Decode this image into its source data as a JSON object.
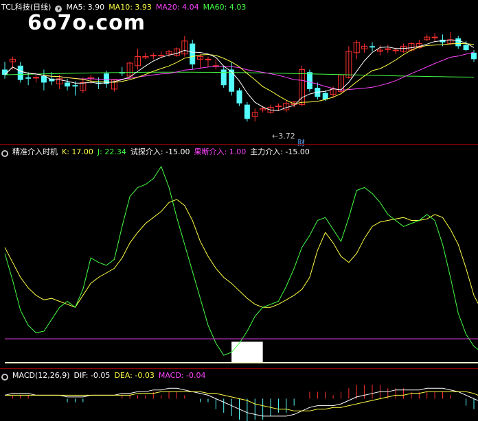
{
  "panels": {
    "main": {
      "title": "TCL科技(日线)",
      "ma": [
        {
          "label": "MA5: 3.90",
          "color": "#ffffff"
        },
        {
          "label": "MA10: 3.93",
          "color": "#ffff44"
        },
        {
          "label": "MA20: 4.04",
          "color": "#ff44ff"
        },
        {
          "label": "MA60: 4.03",
          "color": "#44ff44"
        }
      ],
      "watermark": "6o7o.com",
      "low_label": "3.72",
      "marker": "财"
    },
    "kdj": {
      "title": "精准介入时机",
      "items": [
        {
          "label": "K: 17.00",
          "color": "#ffff44"
        },
        {
          "label": "J: 22.34",
          "color": "#44ff44"
        },
        {
          "label": "试探介入: -15.00",
          "color": "#ffffff"
        },
        {
          "label": "果断介入: 1.00",
          "color": "#ff44ff"
        },
        {
          "label": "主力介入: -15.00",
          "color": "#ffffff"
        }
      ]
    },
    "macd": {
      "title": "MACD(12,26,9)",
      "items": [
        {
          "label": "DIF: -0.05",
          "color": "#ffffff"
        },
        {
          "label": "DEA: -0.03",
          "color": "#ffff44"
        },
        {
          "label": "MACD: -0.04",
          "color": "#ff44ff"
        }
      ]
    }
  },
  "colors": {
    "up": "#ff3030",
    "down": "#54ffff",
    "ma5": "#ffffff",
    "ma10": "#ffff44",
    "ma20": "#ff44ff",
    "ma60": "#44ff44"
  },
  "chart_data": [
    {
      "type": "candlestick",
      "price_range": [
        3.6,
        4.55
      ],
      "candles": [
        {
          "o": 4.12,
          "h": 4.18,
          "l": 4.05,
          "c": 4.08
        },
        {
          "o": 4.18,
          "h": 4.22,
          "l": 4.12,
          "c": 4.2
        },
        {
          "o": 4.15,
          "h": 4.18,
          "l": 4.02,
          "c": 4.04
        },
        {
          "o": 4.06,
          "h": 4.1,
          "l": 4.0,
          "c": 4.05
        },
        {
          "o": 4.06,
          "h": 4.08,
          "l": 4.02,
          "c": 4.06
        },
        {
          "o": 4.07,
          "h": 4.12,
          "l": 3.96,
          "c": 4.02
        },
        {
          "o": 4.05,
          "h": 4.1,
          "l": 4.0,
          "c": 4.03
        },
        {
          "o": 4.01,
          "h": 4.08,
          "l": 3.97,
          "c": 4.05
        },
        {
          "o": 4.02,
          "h": 4.05,
          "l": 3.96,
          "c": 3.99
        },
        {
          "o": 4.0,
          "h": 4.03,
          "l": 3.92,
          "c": 3.99
        },
        {
          "o": 3.96,
          "h": 4.06,
          "l": 3.94,
          "c": 4.02
        },
        {
          "o": 4.05,
          "h": 4.08,
          "l": 4.01,
          "c": 4.06
        },
        {
          "o": 4.02,
          "h": 4.06,
          "l": 3.97,
          "c": 4.01
        },
        {
          "o": 4.09,
          "h": 4.11,
          "l": 3.98,
          "c": 4.01
        },
        {
          "o": 3.97,
          "h": 4.04,
          "l": 3.95,
          "c": 4.04
        },
        {
          "o": 4.1,
          "h": 4.14,
          "l": 4.07,
          "c": 4.09
        },
        {
          "o": 4.07,
          "h": 4.18,
          "l": 4.05,
          "c": 4.17
        },
        {
          "o": 4.15,
          "h": 4.28,
          "l": 4.12,
          "c": 4.22
        },
        {
          "o": 4.21,
          "h": 4.25,
          "l": 4.2,
          "c": 4.22
        },
        {
          "o": 4.23,
          "h": 4.25,
          "l": 4.2,
          "c": 4.23
        },
        {
          "o": 4.23,
          "h": 4.26,
          "l": 4.21,
          "c": 4.23
        },
        {
          "o": 4.24,
          "h": 4.27,
          "l": 4.22,
          "c": 4.26
        },
        {
          "o": 4.23,
          "h": 4.29,
          "l": 4.22,
          "c": 4.28
        },
        {
          "o": 4.24,
          "h": 4.38,
          "l": 4.22,
          "c": 4.34
        },
        {
          "o": 4.32,
          "h": 4.35,
          "l": 4.12,
          "c": 4.16
        },
        {
          "o": 4.2,
          "h": 4.24,
          "l": 4.13,
          "c": 4.22
        },
        {
          "o": 4.2,
          "h": 4.22,
          "l": 4.14,
          "c": 4.2
        },
        {
          "o": 4.15,
          "h": 4.2,
          "l": 4.12,
          "c": 4.15
        },
        {
          "o": 4.12,
          "h": 4.15,
          "l": 3.98,
          "c": 4.0
        },
        {
          "o": 4.12,
          "h": 4.18,
          "l": 3.92,
          "c": 3.95
        },
        {
          "o": 3.96,
          "h": 3.98,
          "l": 3.84,
          "c": 3.86
        },
        {
          "o": 3.85,
          "h": 3.87,
          "l": 3.72,
          "c": 3.74
        },
        {
          "o": 3.76,
          "h": 3.82,
          "l": 3.72,
          "c": 3.79
        },
        {
          "o": 3.81,
          "h": 3.84,
          "l": 3.79,
          "c": 3.82
        },
        {
          "o": 3.79,
          "h": 3.85,
          "l": 3.78,
          "c": 3.83
        },
        {
          "o": 3.84,
          "h": 3.86,
          "l": 3.8,
          "c": 3.84
        },
        {
          "o": 3.81,
          "h": 3.88,
          "l": 3.79,
          "c": 3.86
        },
        {
          "o": 3.85,
          "h": 3.88,
          "l": 3.83,
          "c": 3.87
        },
        {
          "o": 3.85,
          "h": 4.15,
          "l": 3.84,
          "c": 4.12
        },
        {
          "o": 4.1,
          "h": 4.12,
          "l": 3.95,
          "c": 3.97
        },
        {
          "o": 3.98,
          "h": 4.02,
          "l": 3.89,
          "c": 3.91
        },
        {
          "o": 3.94,
          "h": 3.96,
          "l": 3.88,
          "c": 3.89
        },
        {
          "o": 3.93,
          "h": 3.99,
          "l": 3.9,
          "c": 3.97
        },
        {
          "o": 3.95,
          "h": 4.08,
          "l": 3.93,
          "c": 4.08
        },
        {
          "o": 4.06,
          "h": 4.3,
          "l": 4.05,
          "c": 4.26
        },
        {
          "o": 4.25,
          "h": 4.35,
          "l": 4.2,
          "c": 4.33
        },
        {
          "o": 4.28,
          "h": 4.32,
          "l": 4.25,
          "c": 4.3
        },
        {
          "o": 4.3,
          "h": 4.33,
          "l": 4.26,
          "c": 4.29
        },
        {
          "o": 4.26,
          "h": 4.31,
          "l": 4.23,
          "c": 4.27
        },
        {
          "o": 4.28,
          "h": 4.31,
          "l": 4.25,
          "c": 4.28
        },
        {
          "o": 4.27,
          "h": 4.29,
          "l": 4.24,
          "c": 4.27
        },
        {
          "o": 4.26,
          "h": 4.32,
          "l": 4.25,
          "c": 4.3
        },
        {
          "o": 4.27,
          "h": 4.33,
          "l": 4.26,
          "c": 4.32
        },
        {
          "o": 4.29,
          "h": 4.35,
          "l": 4.28,
          "c": 4.32
        },
        {
          "o": 4.35,
          "h": 4.39,
          "l": 4.34,
          "c": 4.37
        },
        {
          "o": 4.37,
          "h": 4.4,
          "l": 4.34,
          "c": 4.37
        },
        {
          "o": 4.35,
          "h": 4.39,
          "l": 4.3,
          "c": 4.33
        },
        {
          "o": 4.32,
          "h": 4.41,
          "l": 4.31,
          "c": 4.35
        },
        {
          "o": 4.36,
          "h": 4.38,
          "l": 4.28,
          "c": 4.3
        },
        {
          "o": 4.31,
          "h": 4.34,
          "l": 4.26,
          "c": 4.27
        },
        {
          "o": 4.25,
          "h": 4.27,
          "l": 4.18,
          "c": 4.2
        }
      ]
    },
    {
      "type": "line",
      "ylim": [
        -15,
        110
      ],
      "series": [
        {
          "name": "K",
          "values": [
            62,
            52,
            42,
            35,
            30,
            27,
            28,
            26,
            24,
            22,
            30,
            38,
            42,
            45,
            48,
            55,
            65,
            72,
            78,
            82,
            86,
            92,
            94,
            90,
            80,
            66,
            56,
            48,
            42,
            38,
            33,
            28,
            24,
            22,
            22,
            24,
            27,
            30,
            34,
            42,
            60,
            72,
            65,
            56,
            52,
            58,
            68,
            76,
            79,
            80,
            81,
            82,
            80,
            80,
            81,
            84,
            82,
            74,
            64,
            48,
            30,
            20,
            17
          ]
        },
        {
          "name": "J",
          "values": [
            58,
            40,
            20,
            10,
            5,
            6,
            14,
            22,
            26,
            22,
            34,
            55,
            52,
            50,
            54,
            76,
            96,
            102,
            104,
            108,
            116,
            102,
            82,
            64,
            46,
            28,
            10,
            -2,
            -10,
            -8,
            -2,
            6,
            16,
            22,
            24,
            26,
            36,
            48,
            62,
            70,
            80,
            82,
            74,
            66,
            82,
            100,
            102,
            98,
            92,
            84,
            80,
            76,
            78,
            80,
            84,
            80,
            64,
            42,
            18,
            4,
            -4,
            -8,
            -12
          ]
        },
        {
          "name": "试探介入",
          "values": [
            -15,
            -15,
            -15,
            -15,
            -15,
            -15,
            -15,
            -15,
            -15,
            -15,
            -15,
            -15,
            -15,
            -15,
            -15,
            -15,
            -15,
            -15,
            -15,
            -15,
            -15,
            -15,
            -15,
            -15,
            -15,
            -15,
            -15,
            -15,
            -15,
            -15,
            -15,
            -15,
            -15,
            -15,
            -15,
            -15,
            -15,
            -15,
            -15,
            -15,
            -15,
            -15,
            -15,
            -15,
            -15,
            -15,
            -15,
            -15,
            -15,
            -15,
            -15,
            -15,
            -15,
            -15,
            -15,
            -15,
            -15,
            -15,
            -15,
            -15,
            -15,
            -15,
            -15
          ]
        },
        {
          "name": "果断介入",
          "values": [
            1,
            1,
            1,
            1,
            1,
            1,
            1,
            1,
            1,
            1,
            1,
            1,
            1,
            1,
            1,
            1,
            1,
            1,
            1,
            1,
            1,
            1,
            1,
            1,
            1,
            1,
            1,
            1,
            1,
            1,
            1,
            1,
            1,
            1,
            1,
            1,
            1,
            1,
            1,
            1,
            1,
            1,
            1,
            1,
            1,
            1,
            1,
            1,
            1,
            1,
            1,
            1,
            1,
            1,
            1,
            1,
            1,
            1,
            1,
            1,
            1,
            1,
            1
          ]
        }
      ],
      "bar": {
        "from": 29,
        "to": 33,
        "value": -15,
        "top": -1
      }
    },
    {
      "type": "macd",
      "ylim": [
        -0.12,
        0.1
      ],
      "dif": [
        0.02,
        0.03,
        0.03,
        0.03,
        0.02,
        0.02,
        0.02,
        0.02,
        0.01,
        0.01,
        0.01,
        0.02,
        0.02,
        0.02,
        0.02,
        0.03,
        0.03,
        0.04,
        0.04,
        0.05,
        0.05,
        0.06,
        0.06,
        0.05,
        0.04,
        0.03,
        0.02,
        0.0,
        -0.02,
        -0.04,
        -0.06,
        -0.08,
        -0.09,
        -0.1,
        -0.1,
        -0.1,
        -0.1,
        -0.09,
        -0.07,
        -0.05,
        -0.04,
        -0.04,
        -0.04,
        -0.03,
        -0.01,
        0.01,
        0.02,
        0.03,
        0.04,
        0.04,
        0.05,
        0.05,
        0.05,
        0.05,
        0.06,
        0.06,
        0.06,
        0.05,
        0.04,
        0.02,
        0.0,
        -0.02,
        -0.05
      ],
      "dea": [
        0.02,
        0.02,
        0.02,
        0.02,
        0.02,
        0.02,
        0.02,
        0.02,
        0.02,
        0.02,
        0.02,
        0.02,
        0.02,
        0.02,
        0.02,
        0.02,
        0.02,
        0.03,
        0.03,
        0.03,
        0.04,
        0.04,
        0.04,
        0.04,
        0.04,
        0.04,
        0.03,
        0.03,
        0.02,
        0.01,
        0.0,
        -0.01,
        -0.03,
        -0.04,
        -0.05,
        -0.06,
        -0.06,
        -0.07,
        -0.07,
        -0.07,
        -0.06,
        -0.06,
        -0.05,
        -0.05,
        -0.04,
        -0.03,
        -0.02,
        -0.01,
        0.0,
        0.01,
        0.02,
        0.02,
        0.03,
        0.03,
        0.04,
        0.04,
        0.04,
        0.04,
        0.04,
        0.04,
        0.03,
        0.01,
        -0.03
      ]
    }
  ]
}
